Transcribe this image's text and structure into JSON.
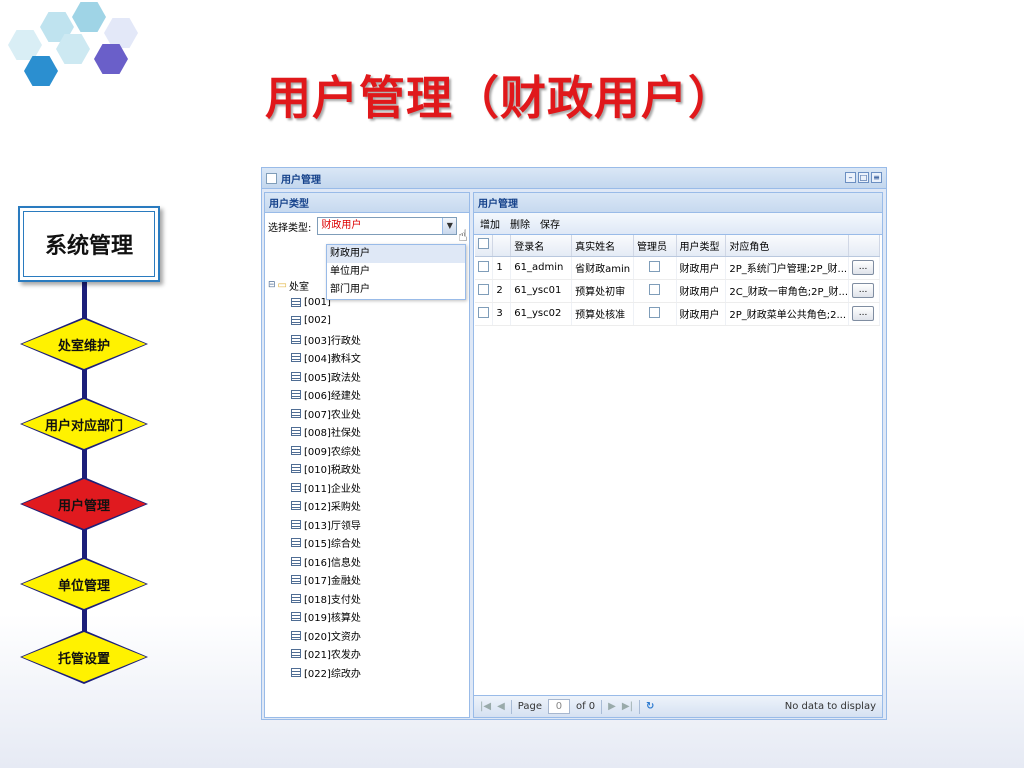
{
  "slide": {
    "title": "用户管理（财政用户）"
  },
  "flow": {
    "system_box": "系统管理",
    "steps": [
      "处室维护",
      "用户对应部门",
      "用户管理",
      "单位管理",
      "托管设置"
    ]
  },
  "window": {
    "title": "用户管理"
  },
  "left_panel": {
    "header": "用户类型",
    "select_label": "选择类型:",
    "select_value": "财政用户",
    "dropdown_options": [
      "财政用户",
      "单位用户",
      "部门用户"
    ],
    "tree_root": "处室",
    "tree_nodes": [
      "[001]",
      "[002]",
      "[003]行政处",
      "[004]教科文",
      "[005]政法处",
      "[006]经建处",
      "[007]农业处",
      "[008]社保处",
      "[009]农综处",
      "[010]税政处",
      "[011]企业处",
      "[012]采购处",
      "[013]厅领导",
      "[015]综合处",
      "[016]信息处",
      "[017]金融处",
      "[018]支付处",
      "[019]核算处",
      "[020]文资办",
      "[021]农发办",
      "[022]综改办"
    ]
  },
  "right_panel": {
    "header": "用户管理",
    "toolbar": {
      "add": "增加",
      "delete": "删除",
      "save": "保存"
    },
    "columns": [
      "登录名",
      "真实姓名",
      "管理员",
      "用户类型",
      "对应角色"
    ],
    "rows": [
      {
        "num": "1",
        "login": "61_admin",
        "name": "省财政amin",
        "type": "财政用户",
        "roles": "2P_系统门户管理;2P_财...",
        "btn": "..."
      },
      {
        "num": "2",
        "login": "61_ysc01",
        "name": "预算处初审",
        "type": "财政用户",
        "roles": "2C_财政一审角色;2P_财...",
        "btn": "..."
      },
      {
        "num": "3",
        "login": "61_ysc02",
        "name": "预算处核准",
        "type": "财政用户",
        "roles": "2P_财政菜单公共角色;2...",
        "btn": "..."
      }
    ],
    "pager": {
      "page_label": "Page",
      "page_value": "0",
      "of_label": "of 0",
      "empty_msg": "No data to display"
    }
  },
  "colors": {
    "title_red": "#e0181b",
    "flow_yellow": "#fff200",
    "flow_red": "#e01a1f",
    "ext_header": "#15428b"
  }
}
